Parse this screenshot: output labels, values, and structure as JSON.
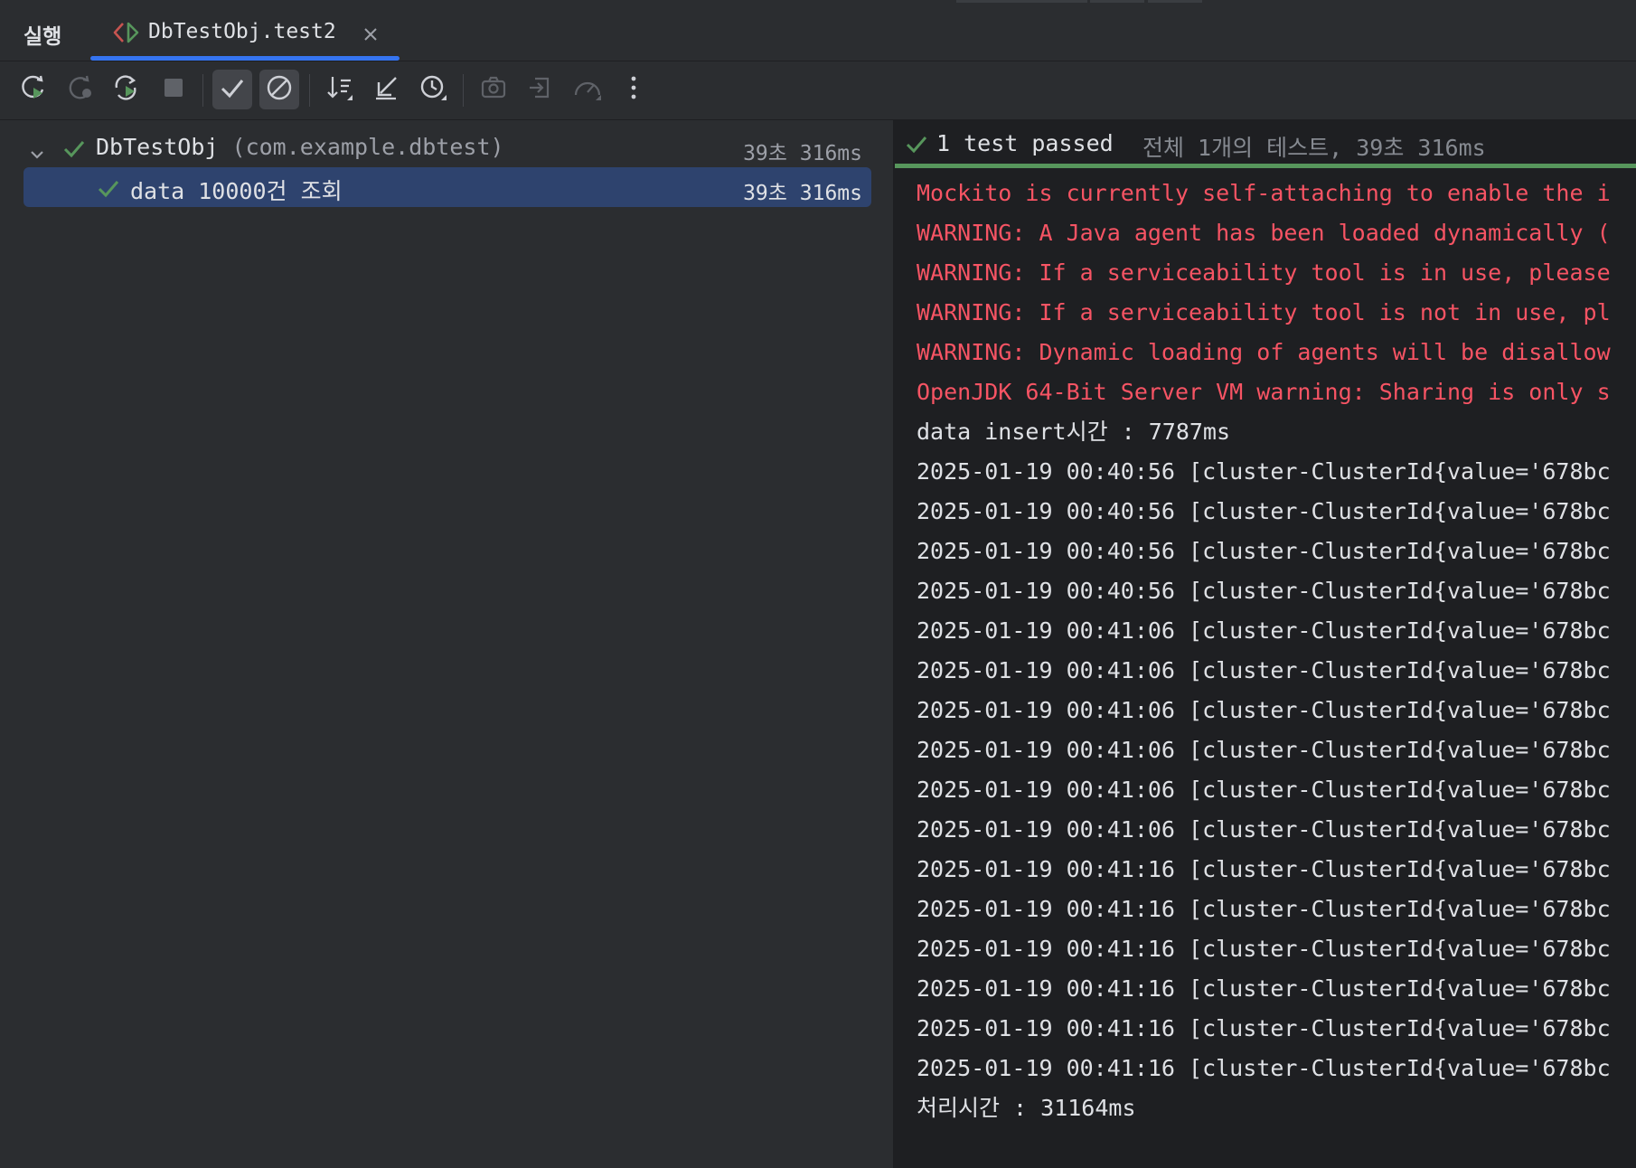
{
  "tabbar": {
    "run_label": "실행",
    "tab_title": "DbTestObj.test2"
  },
  "toolbar": {
    "buttons": [
      {
        "icon": "rerun-icon"
      },
      {
        "icon": "rerun-failed-icon"
      },
      {
        "icon": "toggle-auto-test-icon"
      },
      {
        "icon": "stop-icon"
      },
      {
        "icon": "show-passed-icon",
        "active": true
      },
      {
        "icon": "show-ignored-icon",
        "active": true
      },
      {
        "icon": "sort-icon"
      },
      {
        "icon": "collapse-icon"
      },
      {
        "icon": "history-icon"
      },
      {
        "icon": "screenshot-icon"
      },
      {
        "icon": "import-icon"
      },
      {
        "icon": "coverage-icon"
      },
      {
        "icon": "more-icon"
      }
    ]
  },
  "tree": {
    "root": {
      "name": "DbTestObj",
      "package": "(com.example.dbtest)",
      "duration": "39초 316ms"
    },
    "child": {
      "name": "data 10000건 조회",
      "duration": "39초 316ms"
    }
  },
  "console": {
    "status": "1 test passed",
    "summary": "전체 1개의 테스트, 39초 316ms",
    "lines": [
      {
        "text": "Mockito is currently self-attaching to enable the i",
        "type": "err"
      },
      {
        "text": "WARNING: A Java agent has been loaded dynamically (",
        "type": "err"
      },
      {
        "text": "WARNING: If a serviceability tool is in use, please",
        "type": "err"
      },
      {
        "text": "WARNING: If a serviceability tool is not in use, pl",
        "type": "err"
      },
      {
        "text": "WARNING: Dynamic loading of agents will be disallow",
        "type": "err"
      },
      {
        "text": "OpenJDK 64-Bit Server VM warning: Sharing is only s",
        "type": "err"
      },
      {
        "text": "data insert시간 : 7787ms",
        "type": "out"
      },
      {
        "text": "2025-01-19 00:40:56 [cluster-ClusterId{value='678bc",
        "type": "out"
      },
      {
        "text": "2025-01-19 00:40:56 [cluster-ClusterId{value='678bc",
        "type": "out"
      },
      {
        "text": "2025-01-19 00:40:56 [cluster-ClusterId{value='678bc",
        "type": "out"
      },
      {
        "text": "2025-01-19 00:40:56 [cluster-ClusterId{value='678bc",
        "type": "out"
      },
      {
        "text": "2025-01-19 00:41:06 [cluster-ClusterId{value='678bc",
        "type": "out"
      },
      {
        "text": "2025-01-19 00:41:06 [cluster-ClusterId{value='678bc",
        "type": "out"
      },
      {
        "text": "2025-01-19 00:41:06 [cluster-ClusterId{value='678bc",
        "type": "out"
      },
      {
        "text": "2025-01-19 00:41:06 [cluster-ClusterId{value='678bc",
        "type": "out"
      },
      {
        "text": "2025-01-19 00:41:06 [cluster-ClusterId{value='678bc",
        "type": "out"
      },
      {
        "text": "2025-01-19 00:41:06 [cluster-ClusterId{value='678bc",
        "type": "out"
      },
      {
        "text": "2025-01-19 00:41:16 [cluster-ClusterId{value='678bc",
        "type": "out"
      },
      {
        "text": "2025-01-19 00:41:16 [cluster-ClusterId{value='678bc",
        "type": "out"
      },
      {
        "text": "2025-01-19 00:41:16 [cluster-ClusterId{value='678bc",
        "type": "out"
      },
      {
        "text": "2025-01-19 00:41:16 [cluster-ClusterId{value='678bc",
        "type": "out"
      },
      {
        "text": "2025-01-19 00:41:16 [cluster-ClusterId{value='678bc",
        "type": "out"
      },
      {
        "text": "2025-01-19 00:41:16 [cluster-ClusterId{value='678bc",
        "type": "out"
      },
      {
        "text": "처리시간 : 31164ms",
        "type": "out"
      }
    ]
  },
  "colors": {
    "accent": "#3574f0",
    "pass_green": "#57965c",
    "error_red": "#f75464",
    "selection": "#2e436e"
  }
}
